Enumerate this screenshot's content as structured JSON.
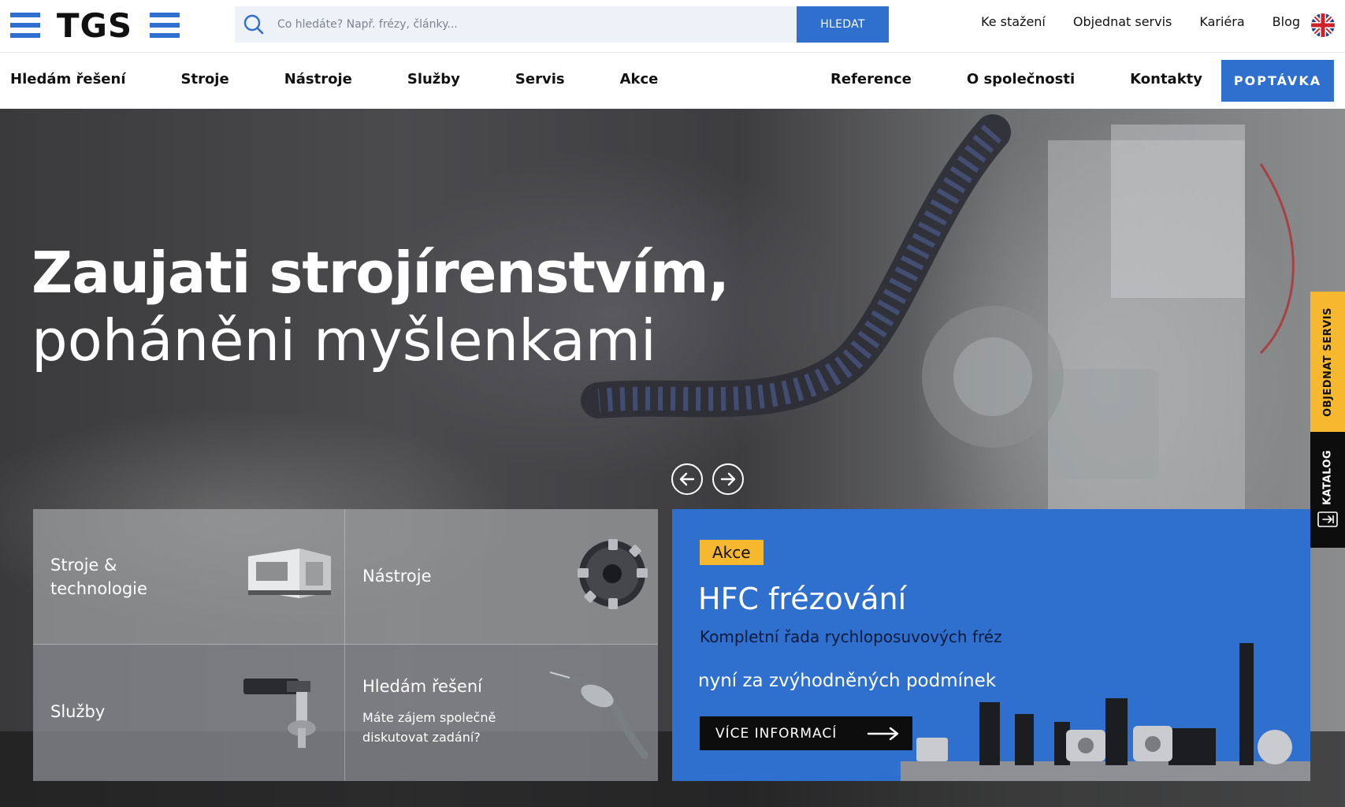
{
  "brand": {
    "logo_text": "TGS",
    "accent": "#2f6fce",
    "yellow": "#f5b82e"
  },
  "search": {
    "placeholder": "Co hledáte? Např. frézy, články...",
    "button_label": "HLEDAT"
  },
  "top_links": [
    "Ke stažení",
    "Objednat servis",
    "Kariéra",
    "Blog"
  ],
  "main_nav": {
    "left": [
      "Hledám řešení",
      "Stroje",
      "Nástroje",
      "Služby",
      "Servis",
      "Akce"
    ],
    "right": [
      "Reference",
      "O společnosti",
      "Kontakty"
    ],
    "cta": "POPTÁVKA"
  },
  "hero": {
    "title_line1": "Zaujati strojírenstvím,",
    "title_line2": "poháněni myšlenkami"
  },
  "tiles": [
    {
      "label_line1": "Stroje &",
      "label_line2": "technologie"
    },
    {
      "label": "Nástroje"
    },
    {
      "label": "Služby"
    },
    {
      "label": "Hledám řešení",
      "sub_line1": "Máte zájem společně",
      "sub_line2": "diskutovat zadání?"
    }
  ],
  "promo": {
    "badge": "Akce",
    "title": "HFC frézování",
    "line1": "Kompletní řada rychloposuvových fréz",
    "line2": "nyní za zvýhodněných podmínek",
    "button": "VÍCE INFORMACÍ"
  },
  "side_tabs": {
    "servis": "OBJEDNAT SERVIS",
    "katalog": "KATALOG"
  }
}
